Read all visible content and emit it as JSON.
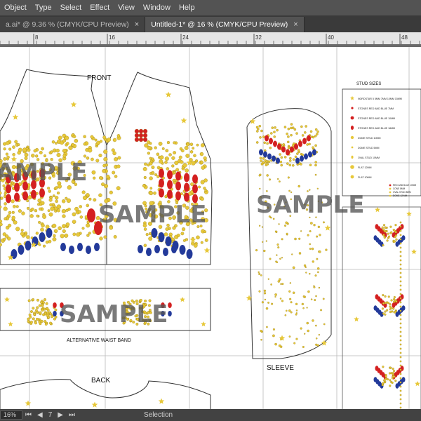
{
  "menu": [
    "Object",
    "Type",
    "Select",
    "Effect",
    "View",
    "Window",
    "Help"
  ],
  "tabs": [
    {
      "label": "a.ai* @ 9.36 % (CMYK/CPU Preview)"
    },
    {
      "label": "Untitled-1* @ 16 % (CMYK/CPU Preview)"
    }
  ],
  "ruler": {
    "ticks": [
      "8",
      "16",
      "24",
      "32",
      "40",
      "48"
    ]
  },
  "artwork": {
    "front_label": "FRONT",
    "back_label": "BACK",
    "sleeve_label": "SLEEVE",
    "waistband_label": "ALTERNATIVE WAIST BAND",
    "watermark": "SAMPLE"
  },
  "legend": {
    "title": "STUD SIZES",
    "items": [
      "NORDSTAR 5 5MM 7MM 10MM 15MM",
      "STONES RED AND BLUE 7MM",
      "STONES RED AND BLUE 10MM",
      "STONES RED AND BLUE 18MM",
      "DOME STUD 10MM",
      "DOME STUD 5MM",
      "OVAL STUD 10MM",
      "FLAT 12MM",
      "FLAT 10MM",
      "RED AND BLUE 10MM",
      "CONE 8MM",
      "OVAL STUD 8MM",
      "DOME 12 MM"
    ]
  },
  "status": {
    "zoom": "16%",
    "page": "7",
    "tool": "Selection"
  },
  "colors": {
    "gold": "#e7c83a",
    "red": "#d42020",
    "blue": "#233a9a",
    "outline": "#333333"
  }
}
